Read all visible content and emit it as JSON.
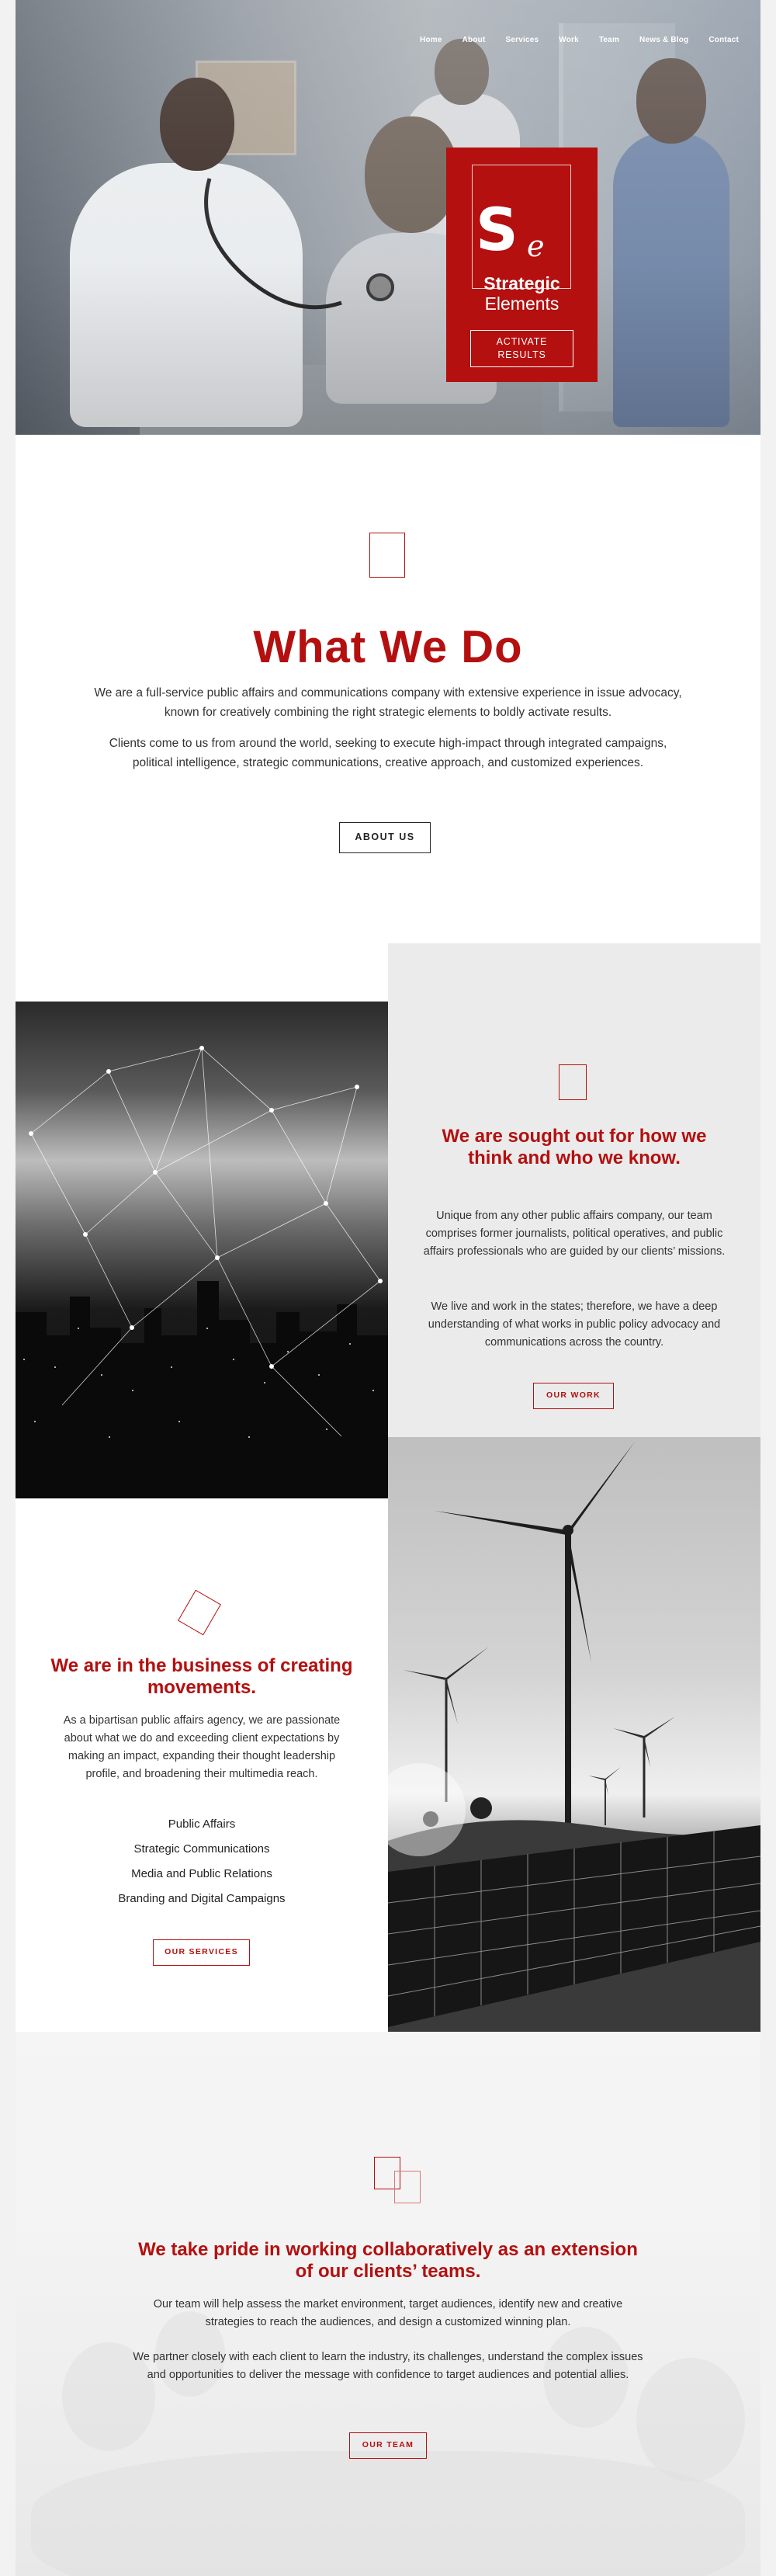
{
  "nav": {
    "items": [
      "Home",
      "About",
      "Services",
      "Work",
      "Team",
      "News & Blog",
      "Contact"
    ]
  },
  "logo": {
    "initial": "S",
    "script_letter": "e",
    "name_line1": "Strategic",
    "name_line2": "Elements",
    "tagline_line1": "ACTIVATE",
    "tagline_line2": "RESULTS"
  },
  "what_we_do": {
    "title": "What We Do",
    "p1": "We are a full-service public affairs and communications company with extensive experience in issue advocacy, known for creatively combining the right strategic elements to boldly activate results.",
    "p2": "Clients come to us from around the world, seeking to execute high-impact through integrated campaigns, political intelligence, strategic communications, creative approach, and customized experiences.",
    "button": "ABOUT US"
  },
  "sought_out": {
    "title": "We are sought out for how we think and who we know.",
    "p1": "Unique from any other public affairs company, our team comprises former journalists, political operatives, and public affairs professionals who are guided by our clients’ missions.",
    "p2": "We live and work in the states; therefore, we have a deep understanding of what works in public policy advocacy and communications across the country.",
    "button": "OUR WORK"
  },
  "movements": {
    "title": "We are in the business of creating movements.",
    "p1": "As a bipartisan public affairs agency, we are passionate about what we do and exceeding client expectations by making an impact, expanding their thought leadership profile, and broadening their multimedia reach.",
    "services": [
      "Public Affairs",
      "Strategic Communications",
      "Media and Public Relations",
      "Branding and Digital Campaigns"
    ],
    "button": "OUR SERVICES"
  },
  "team": {
    "title": "We take pride in working collaboratively as an extension of our clients’ teams.",
    "p1": "Our team will help assess the market environment, target audiences, identify new and creative strategies to reach the audiences, and design a customized winning plan.",
    "p2": "We partner closely with each client to learn the industry, its challenges, understand the complex issues and opportunities to deliver the message with confidence to target audiences and potential allies.",
    "button": "OUR TEAM"
  },
  "colors": {
    "brand_red": "#b3100f",
    "panel_grey": "#ebebeb",
    "text_dark": "#333333"
  }
}
